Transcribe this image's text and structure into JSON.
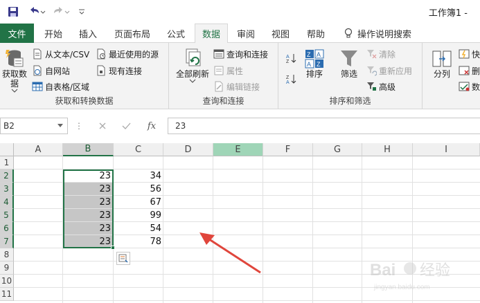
{
  "titlebar": {
    "title": "工作簿1 -"
  },
  "tabs": {
    "file": "文件",
    "items": [
      "开始",
      "插入",
      "页面布局",
      "公式",
      "数据",
      "审阅",
      "视图",
      "帮助"
    ],
    "active": "数据",
    "search": "操作说明搜索"
  },
  "ribbon": {
    "get_transform": {
      "label": "获取和转换数据",
      "get_data": "获取数据",
      "from_text": "从文本/CSV",
      "from_web": "自网站",
      "from_table": "自表格/区域",
      "recent_sources": "最近使用的源",
      "existing_conn": "现有连接"
    },
    "queries": {
      "label": "查询和连接",
      "refresh_all": "全部刷新",
      "queries_conn": "查询和连接",
      "properties": "属性",
      "edit_links": "编辑链接"
    },
    "sort_filter": {
      "label": "排序和筛选",
      "sort": "排序",
      "filter": "筛选",
      "clear": "清除",
      "reapply": "重新应用",
      "advanced": "高级"
    },
    "data_tools": {
      "text_to_columns": "分列",
      "flash_fill": "快",
      "remove_dup": "删",
      "validation": "数"
    }
  },
  "formula_bar": {
    "name_box": "B2",
    "fx": "fx",
    "value": "23"
  },
  "grid": {
    "columns": [
      "A",
      "B",
      "C",
      "D",
      "E",
      "F",
      "G",
      "H",
      "I"
    ],
    "rows": [
      "1",
      "2",
      "3",
      "4",
      "5",
      "6",
      "7",
      "8",
      "9",
      "10",
      "11"
    ],
    "col_b": [
      "23",
      "23",
      "23",
      "23",
      "23",
      "23"
    ],
    "col_c": [
      "34",
      "56",
      "67",
      "99",
      "54",
      "78"
    ]
  },
  "watermark": "Baidu 经验 jingyan.baidu.com",
  "colors": {
    "accent": "#217346",
    "selection": "#c6c6c6",
    "arrow": "#e0463c"
  }
}
